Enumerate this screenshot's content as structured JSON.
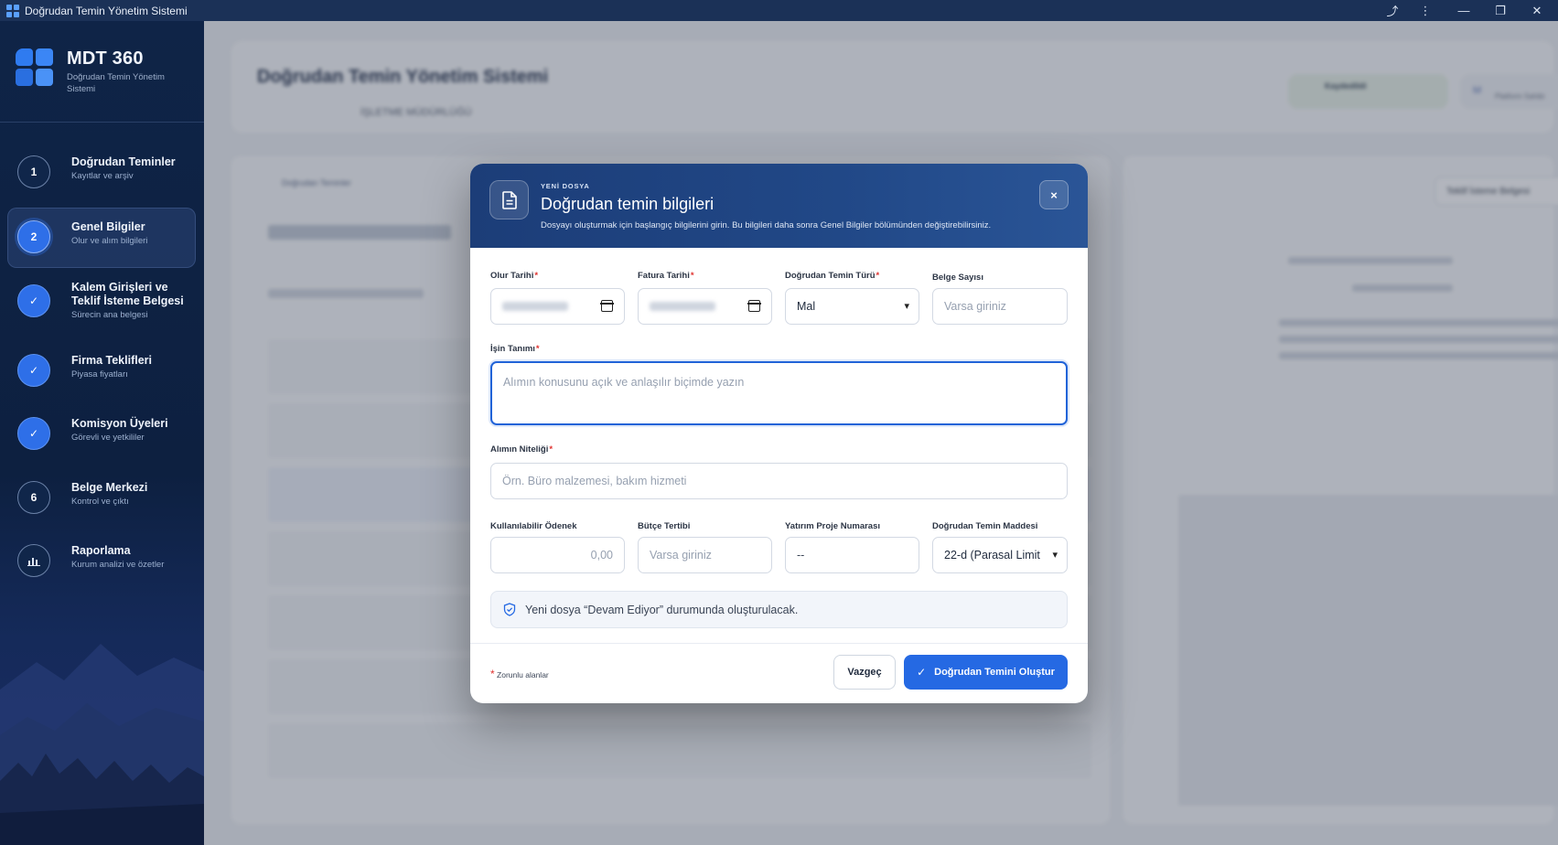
{
  "window": {
    "title": "Doğrudan Temin Yönetim Sistemi"
  },
  "brand": {
    "name": "MDT 360",
    "subtitle": "Doğrudan Temin Yönetim Sistemi"
  },
  "steps": [
    {
      "badge": "1",
      "title": "Doğrudan Teminler",
      "subtitle": "Kayıtlar ve arşiv",
      "state": "number"
    },
    {
      "badge": "2",
      "title": "Genel Bilgiler",
      "subtitle": "Olur ve alım bilgileri",
      "state": "current"
    },
    {
      "badge": "✓",
      "title": "Kalem Girişleri ve Teklif İsteme Belgesi",
      "subtitle": "Sürecin ana belgesi",
      "state": "done"
    },
    {
      "badge": "✓",
      "title": "Firma Teklifleri",
      "subtitle": "Piyasa fiyatları",
      "state": "done"
    },
    {
      "badge": "✓",
      "title": "Komisyon Üyeleri",
      "subtitle": "Görevli ve yetkililer",
      "state": "done"
    },
    {
      "badge": "6",
      "title": "Belge Merkezi",
      "subtitle": "Kontrol ve çıktı",
      "state": "number"
    },
    {
      "badge": "📊",
      "title": "Raporlama",
      "subtitle": "Kurum analizi ve özetler",
      "state": "icon"
    }
  ],
  "modal": {
    "eyebrow": "YENİ DOSYA",
    "title": "Doğrudan temin bilgileri",
    "description": "Dosyayı oluşturmak için başlangıç bilgilerini girin. Bu bilgileri daha sonra Genel Bilgiler bölümünden değiştirebilirsiniz.",
    "close_label": "×",
    "fields": {
      "olur_tarihi": {
        "label": "Olur Tarihi",
        "required": "*"
      },
      "fatura_tarihi": {
        "label": "Fatura Tarihi",
        "required": "*"
      },
      "temin_turu": {
        "label": "Doğrudan Temin Türü",
        "required": "*",
        "value": "Mal"
      },
      "belge_sayisi": {
        "label": "Belge Sayısı",
        "placeholder": "Varsa giriniz"
      },
      "isin_tanimi": {
        "label": "İşin Tanımı",
        "required": "*",
        "placeholder": "Alımın konusunu açık ve anlaşılır biçimde yazın"
      },
      "alimin_niteligi": {
        "label": "Alımın Niteliği",
        "required": "*",
        "placeholder": "Örn. Büro malzemesi, bakım hizmeti"
      },
      "kullanilabilir_odenek": {
        "label": "Kullanılabilir Ödenek",
        "value": "0,00"
      },
      "butce_tertibi": {
        "label": "Bütçe Tertibi",
        "placeholder": "Varsa giriniz"
      },
      "yatirim_proje": {
        "label": "Yatırım Proje Numarası",
        "value": "--"
      },
      "temin_maddesi": {
        "label": "Doğrudan Temin Maddesi",
        "value": "22-d (Parasal Limit"
      }
    },
    "notice": "Yeni dosya “Devam Ediyor” durumunda oluşturulacak.",
    "required_note": "Zorunlu alanlar",
    "required_mark": "*",
    "cancel_label": "Vazgeç",
    "create_label": "Doğrudan Temini Oluştur"
  },
  "background": {
    "header_title": "Doğrudan Temin Yönetim Sistemi",
    "header_sub": "İŞLETME MÜDÜRLÜĞÜ",
    "saved_label": "Kaydedildi",
    "user_role": "Platform Sahibi",
    "user_initial": "M",
    "breadcrumb": "Doğrudan Teminler",
    "doc_select": "Teklif İsteme Belgesi"
  },
  "colors": {
    "accent": "#2569e3",
    "modal_header": "#1c3d78",
    "required": "#e0322f"
  }
}
